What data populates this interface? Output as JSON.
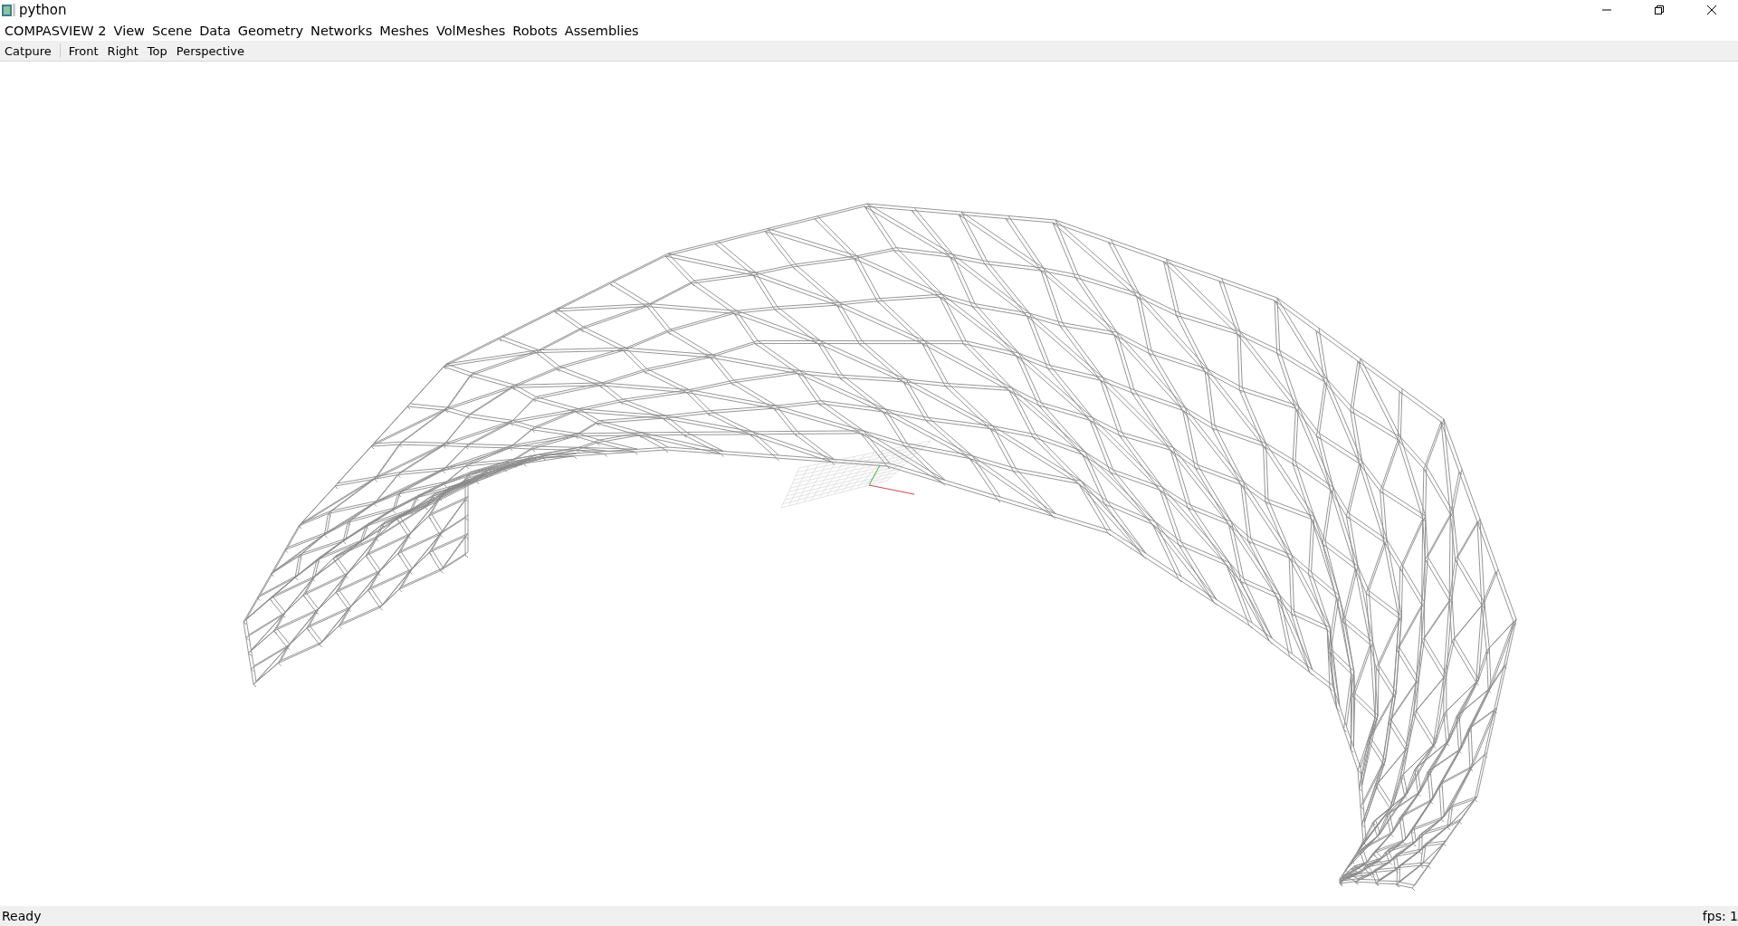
{
  "window": {
    "title": "python"
  },
  "menu": [
    {
      "label": "COMPASVIEW 2"
    },
    {
      "label": "View"
    },
    {
      "label": "Scene"
    },
    {
      "label": "Data"
    },
    {
      "label": "Geometry"
    },
    {
      "label": "Networks"
    },
    {
      "label": "Meshes"
    },
    {
      "label": "VolMeshes"
    },
    {
      "label": "Robots"
    },
    {
      "label": "Assemblies"
    }
  ],
  "toolbar": [
    {
      "label": "Catpure"
    },
    {
      "label": "Front"
    },
    {
      "label": "Right"
    },
    {
      "label": "Top"
    },
    {
      "label": "Perspective"
    }
  ],
  "status_bar": {
    "message": "Ready",
    "fps": "fps: 1"
  }
}
